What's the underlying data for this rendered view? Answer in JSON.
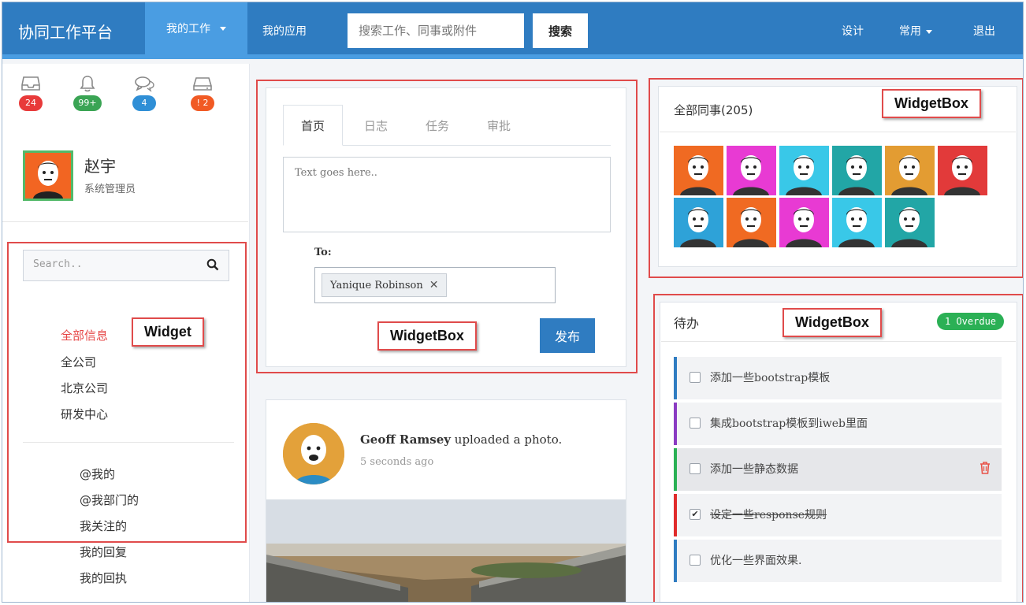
{
  "navbar": {
    "brand": "协同工作平台",
    "my_work": "我的工作",
    "my_apps": "我的应用",
    "search_placeholder": "搜索工作、同事或附件",
    "search_button": "搜索",
    "design": "设计",
    "common": "常用",
    "logout": "退出"
  },
  "notifications": [
    {
      "icon": "inbox-icon",
      "count": "24",
      "color": "#e83a3a"
    },
    {
      "icon": "bell-icon",
      "count": "99+",
      "color": "#3aa454"
    },
    {
      "icon": "chat-icon",
      "count": "4",
      "color": "#2f8fd6"
    },
    {
      "icon": "drive-icon",
      "count": "! 2",
      "color": "#f15a24"
    }
  ],
  "profile": {
    "name": "赵宇",
    "role": "系统管理员"
  },
  "left_search": {
    "placeholder": "Search.."
  },
  "left_menu": {
    "groups": [
      "全部信息",
      "全公司",
      "北京公司",
      "研发中心"
    ],
    "personal": [
      "@我的",
      "@我部门的",
      "我关注的",
      "我的回复",
      "我的回执"
    ]
  },
  "annotations": {
    "widget": "Widget",
    "widget_box": "WidgetBox"
  },
  "composer": {
    "tabs": [
      "首页",
      "日志",
      "任务",
      "审批"
    ],
    "placeholder": "Text goes here..",
    "to_label": "To:",
    "recipient": "Yanique Robinson",
    "publish": "发布"
  },
  "feed": {
    "user": "Geoff Ramsey",
    "action": "uploaded a photo.",
    "time": "5 seconds ago"
  },
  "colleagues": {
    "title": "全部同事(205)",
    "tile_colors": [
      "#f06a22",
      "#e83ad3",
      "#39c8e8",
      "#22a6a6",
      "#e39c32",
      "#e23a3a",
      "#2ea2d8",
      "#f06a22",
      "#e83ad3",
      "#39c8e8",
      "#22a6a6"
    ]
  },
  "todo": {
    "title": "待办",
    "overdue": "1 Overdue",
    "items": [
      {
        "text": "添加一些bootstrap模板",
        "color": "#2f7cc1",
        "checked": false
      },
      {
        "text": "集成bootstrap模板到iweb里面",
        "color": "#8a3bc2",
        "checked": false
      },
      {
        "text": "添加一些静态数据",
        "color": "#2bb055",
        "checked": false
      },
      {
        "text": "设定一些response规则",
        "color": "#e02b2b",
        "checked": true
      },
      {
        "text": "优化一些界面效果.",
        "color": "#2f7cc1",
        "checked": false
      }
    ]
  }
}
